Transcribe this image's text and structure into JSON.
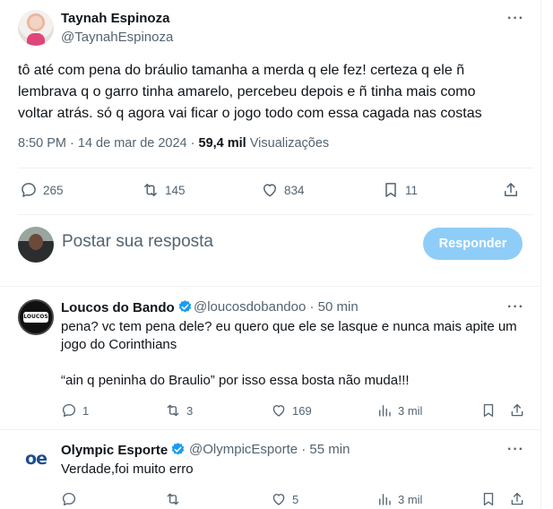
{
  "main_tweet": {
    "author_name": "Taynah Espinoza",
    "author_handle": "@TaynahEspinoza",
    "more_label": "···",
    "text_lines": [
      "tô até com pena do bráulio tamanha a merda q ele fez! certeza q ele ñ",
      "lembrava q o garro tinha amarelo, percebeu depois e ñ tinha mais como",
      "voltar atrás. só q agora vai ficar o jogo todo com essa cagada nas costas"
    ],
    "time": "8:50 PM",
    "date": "· 14 de mar de 2024 ·",
    "views_count": "59,4 mil",
    "views_label": "Visualizações",
    "replies": "265",
    "retweets": "145",
    "likes": "834",
    "bookmarks": "11"
  },
  "reply_box": {
    "placeholder": "Postar sua resposta",
    "button_label": "Responder"
  },
  "replies": [
    {
      "author_name": "Loucos do Bando",
      "author_handle": "@loucosdobandoo",
      "time": "· 50 min",
      "avatar_text": "LOUCOS BANDO",
      "text_lines": [
        "pena? vc tem pena dele? eu quero que ele se lasque e nunca mais apite um",
        "jogo do Corinthians",
        "",
        "“ain q peninha do Braulio” por isso essa bosta não muda!!!"
      ],
      "replies": "1",
      "retweets": "3",
      "likes": "169",
      "views": "3 mil"
    },
    {
      "author_name": "Olympic Esporte",
      "author_handle": "@OlympicEsporte",
      "time": "· 55 min",
      "avatar_text": "oe",
      "text_lines": [
        "Verdade,foi muito erro"
      ],
      "replies": "",
      "retweets": "",
      "likes": "5",
      "views": "3 mil"
    }
  ],
  "colors": {
    "verified_blue": "#1d9bf0",
    "reply_button": "#8ecdf8",
    "secondary_text": "#536471"
  }
}
